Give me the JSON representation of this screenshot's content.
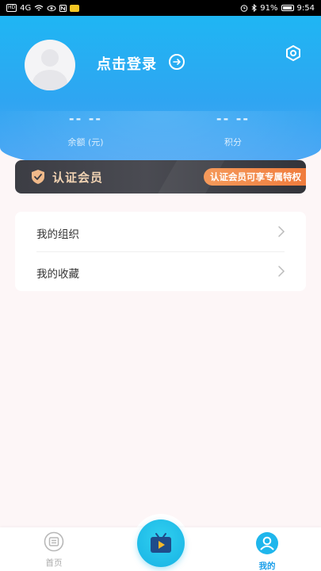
{
  "status_bar": {
    "left_chip": "HD",
    "signal": "4G",
    "battery": "91%",
    "time": "9:54"
  },
  "profile": {
    "login_label": "点击登录"
  },
  "stats": {
    "balance_value": "-- --",
    "balance_label": "余额 (元)",
    "points_value": "-- --",
    "points_label": "积分"
  },
  "vip": {
    "title": "认证会员",
    "badge": "认证会员可享专属特权"
  },
  "menu": {
    "items": [
      {
        "label": "我的组织"
      },
      {
        "label": "我的收藏"
      }
    ]
  },
  "tabs": {
    "home": "首页",
    "mine": "我的"
  },
  "colors": {
    "header_blue": "#1fb6f3",
    "vip_gold": "#f1d3b3",
    "vip_badge": "#f07c3d",
    "tab_active": "#1a9ee9"
  }
}
